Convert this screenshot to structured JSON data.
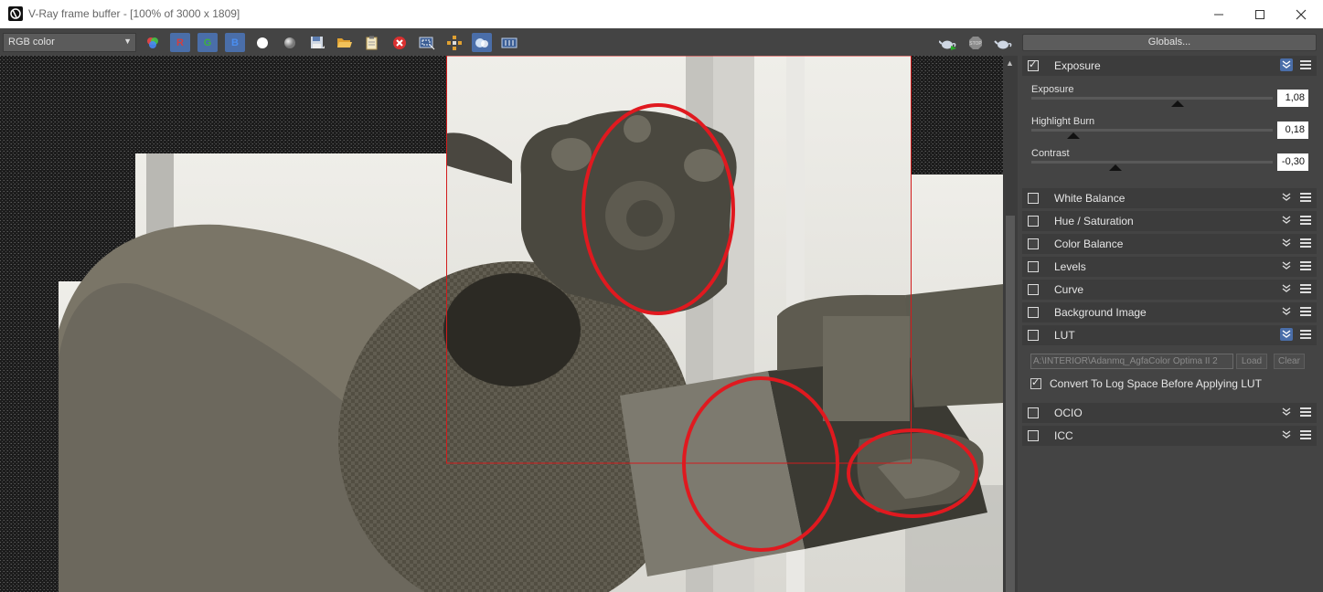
{
  "window": {
    "title": "V-Ray frame buffer - [100% of 3000 x 1809]",
    "controls": [
      "minimize",
      "maximize",
      "close"
    ]
  },
  "toolbar": {
    "channel": "RGB color",
    "channel_buttons": [
      "R",
      "G",
      "B"
    ],
    "icons": [
      "color-wheel-icon",
      "red-channel",
      "green-channel",
      "blue-channel",
      "white-circle-icon",
      "gray-circle-icon",
      "save-icon",
      "open-folder-icon",
      "clipboard-icon",
      "clear-icon",
      "region-icon",
      "track-icon",
      "lens-icon",
      "history-icon",
      "render-icon",
      "stop-icon",
      "render-last-icon"
    ]
  },
  "panel": {
    "globals_label": "Globals...",
    "exposure": {
      "label": "Exposure",
      "enabled": true,
      "sliders": [
        {
          "label": "Exposure",
          "value": "1,08",
          "fraction": 0.61
        },
        {
          "label": "Highlight Burn",
          "value": "0,18",
          "fraction": 0.18
        },
        {
          "label": "Contrast",
          "value": "-0,30",
          "fraction": 0.35
        }
      ]
    },
    "sections": [
      {
        "label": "White Balance",
        "enabled": false
      },
      {
        "label": "Hue / Saturation",
        "enabled": false
      },
      {
        "label": "Color Balance",
        "enabled": false
      },
      {
        "label": "Levels",
        "enabled": false
      },
      {
        "label": "Curve",
        "enabled": false
      },
      {
        "label": "Background Image",
        "enabled": false
      }
    ],
    "lut": {
      "label": "LUT",
      "enabled": false,
      "path": "A:\\INTERIOR\\Adanmq_AgfaColor Optima II 2",
      "load_label": "Load",
      "clear_label": "Clear",
      "convert_label": "Convert To Log Space Before Applying LUT",
      "convert_checked": true
    },
    "after_sections": [
      {
        "label": "OCIO",
        "enabled": false
      },
      {
        "label": "ICC",
        "enabled": false
      }
    ]
  },
  "colors": {
    "panel_bg": "#444444",
    "accent": "#4a6ea9",
    "annotation": "#e0191f"
  }
}
